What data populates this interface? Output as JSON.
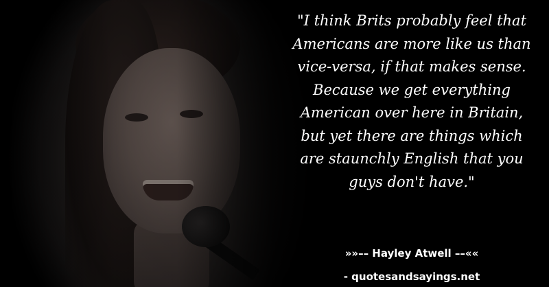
{
  "quote": {
    "lines": [
      "\"I think Brits probably feel that",
      "Americans are more like us than",
      "vice-versa, if that makes sense.",
      "Because we get everything",
      "American over here in Britain,",
      "but yet there are things which",
      "are staunchly English that you",
      "guys don't have.\""
    ]
  },
  "author": "»»–– Hayley Atwell ––««",
  "source": "- quotesandsayings.net",
  "colors": {
    "background": "#000000",
    "text": "#ffffff"
  }
}
